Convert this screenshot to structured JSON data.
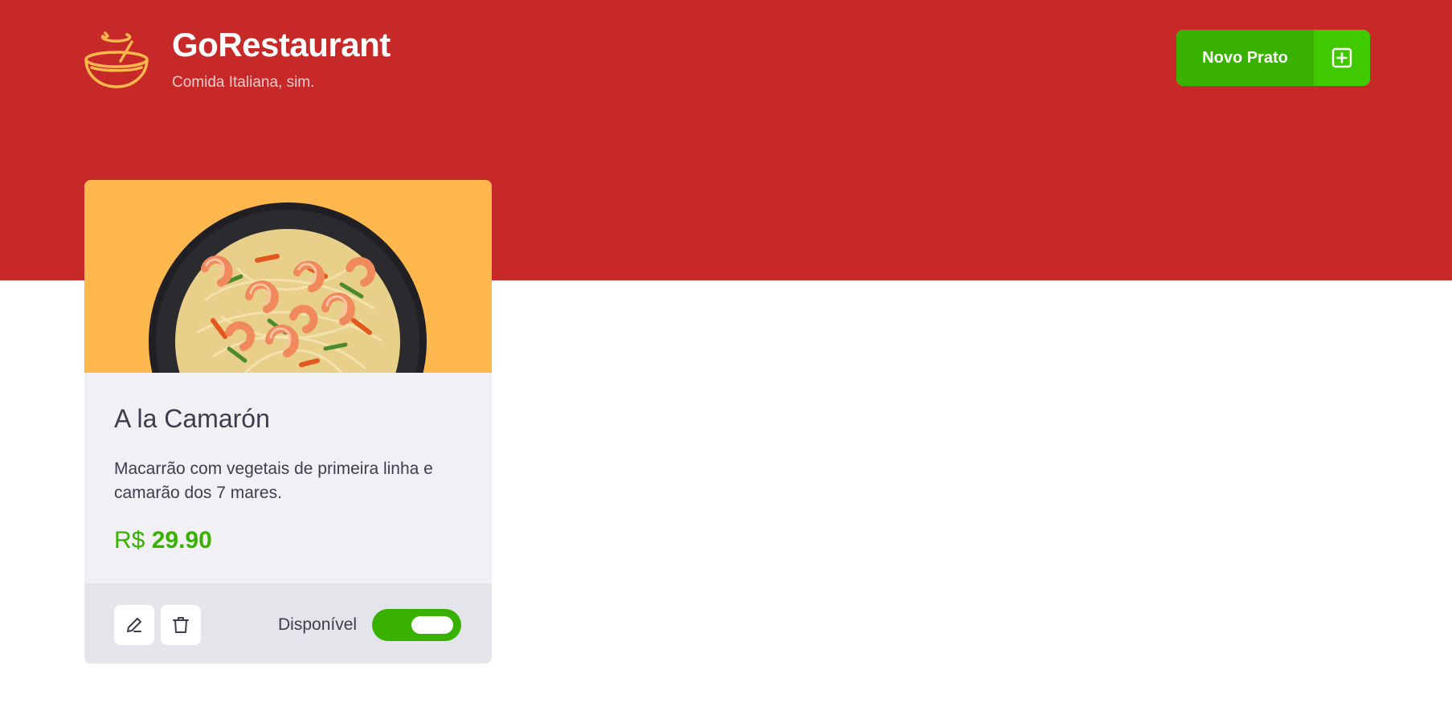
{
  "header": {
    "brand_title": "GoRestaurant",
    "brand_subtitle": "Comida Italiana, sim.",
    "logo_icon": "bowl-icon",
    "new_dish_button": {
      "label": "Novo Prato",
      "icon": "plus-square-icon"
    }
  },
  "colors": {
    "header_bg": "#c72828",
    "button_green": "#39b100",
    "button_icon_green": "#41c900",
    "card_image_bg": "#ffb84d",
    "card_body_bg": "#f0f0f5",
    "card_footer_bg": "#e4e4eb",
    "text_dark": "#3d3d4d",
    "logo_orange": "#ffb84d"
  },
  "foods": [
    {
      "name": "A la Camarón",
      "description": "Macarrão com vegetais de primeira linha e camarão dos 7 mares.",
      "currency": "R$",
      "price": "29.90",
      "image_icon": "shrimp-pasta-dish-image",
      "edit_icon": "pencil-icon",
      "delete_icon": "trash-icon",
      "availability_label": "Disponível",
      "available": true
    }
  ]
}
